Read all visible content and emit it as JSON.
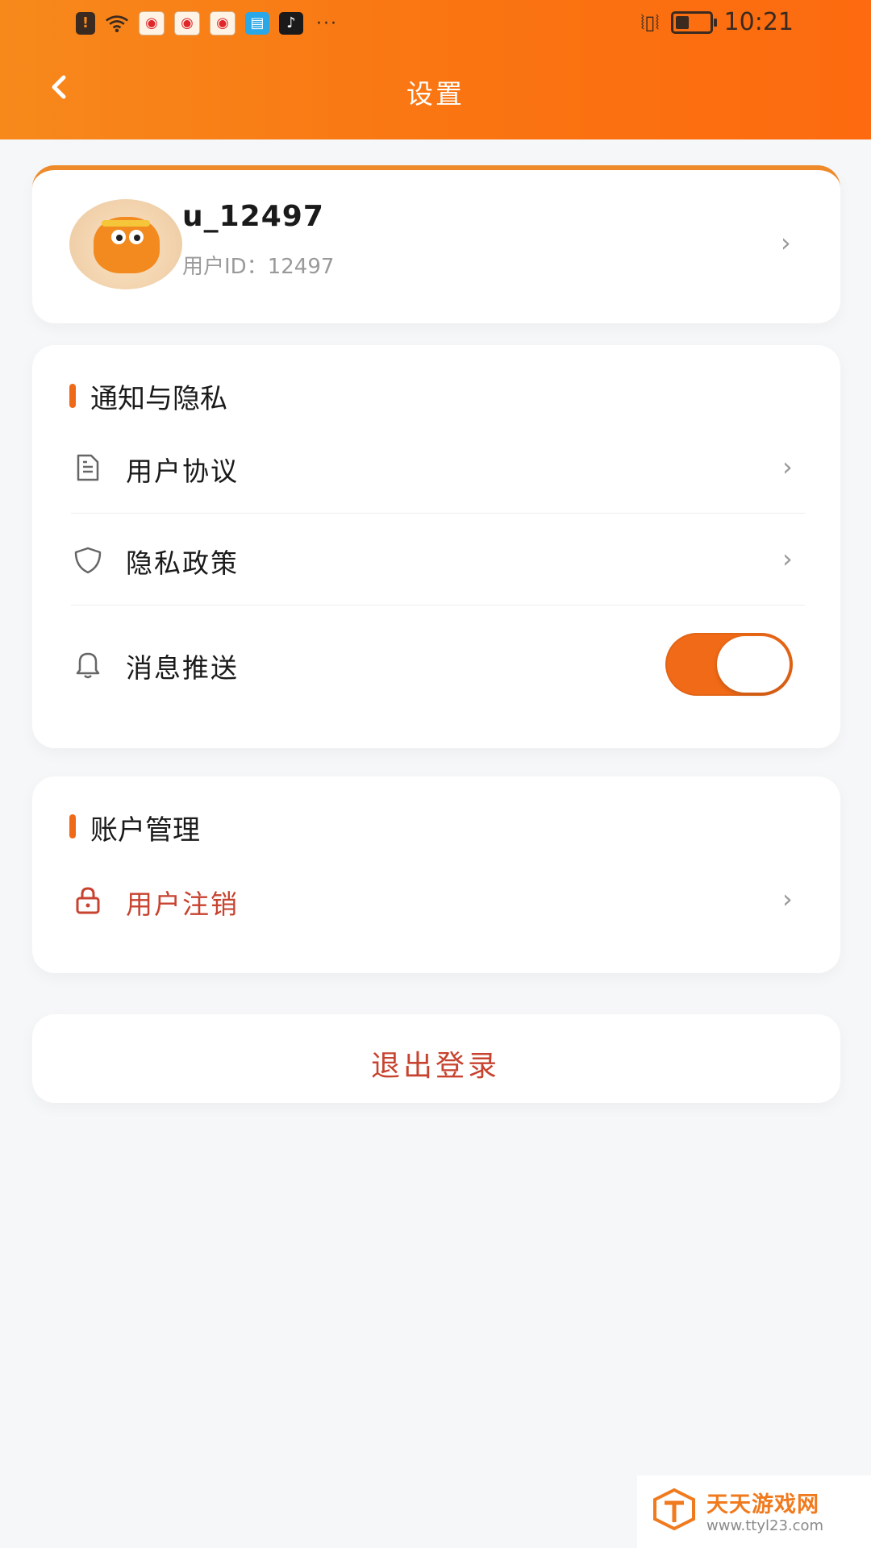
{
  "status_bar": {
    "time": "10:21",
    "icons": [
      "alert-icon",
      "wifi-icon",
      "weibo-icon",
      "weibo-icon",
      "weibo-icon",
      "book-app-icon",
      "tiktok-icon",
      "more-icon",
      "vibrate-icon",
      "battery-icon"
    ],
    "battery_level": 0.4
  },
  "header": {
    "title": "设置",
    "back_icon": "chevron-left-icon"
  },
  "profile": {
    "username": "u_12497",
    "user_id": "用户ID：12497"
  },
  "notification_privacy": {
    "title": "通知与隐私",
    "items": [
      {
        "label": "用户协议",
        "icon": "document-icon"
      },
      {
        "label": "隐私政策",
        "icon": "shield-icon"
      },
      {
        "label": "消息推送",
        "icon": "bell-icon",
        "toggle_on": true
      }
    ]
  },
  "account": {
    "title": "账户管理",
    "items": [
      {
        "label": "用户注销",
        "icon": "lock-icon"
      }
    ]
  },
  "logout": {
    "label": "退出登录"
  },
  "watermark": {
    "title": "天天游戏网",
    "url": "www.ttyl23.com"
  },
  "colors": {
    "accent": "#f06a17",
    "danger": "#c7432f"
  }
}
